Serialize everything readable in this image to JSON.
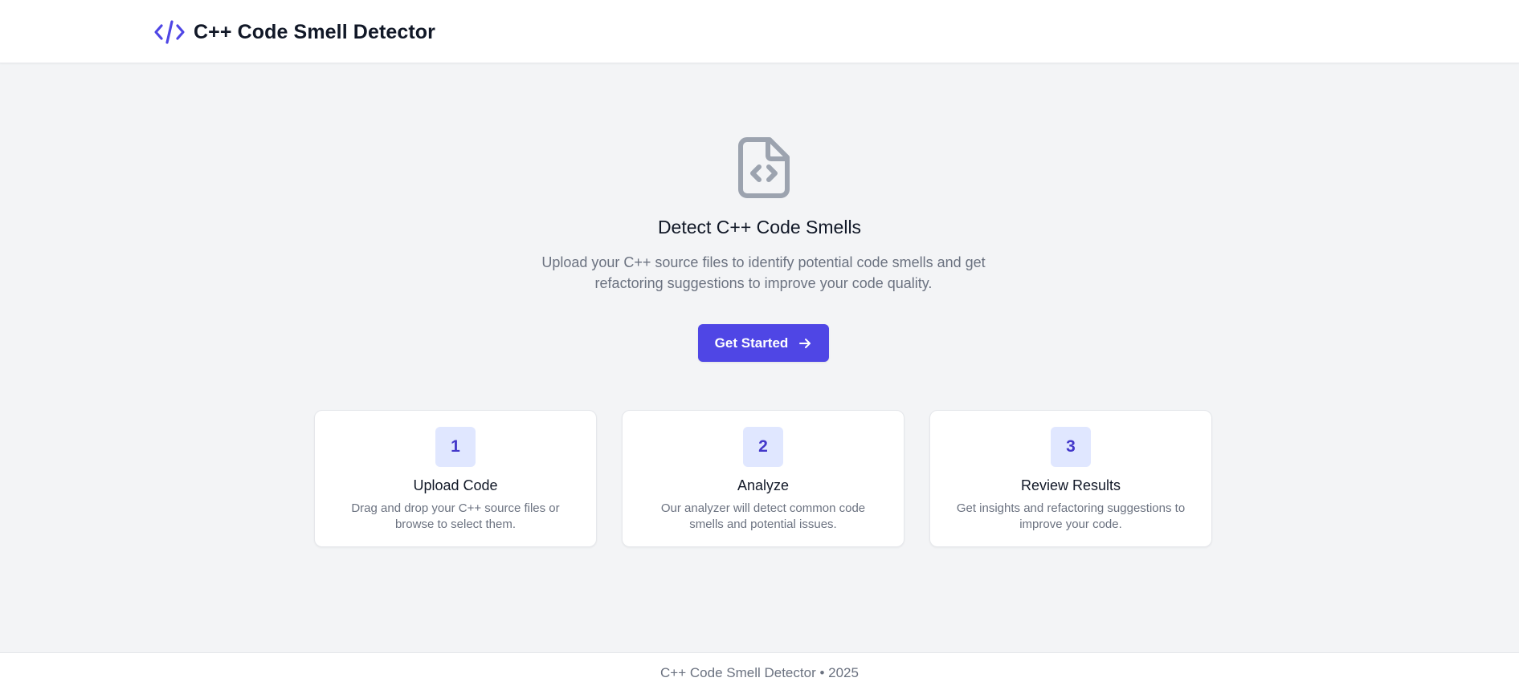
{
  "colors": {
    "accent": "#4f46e5",
    "badge_bg": "#e0e7ff",
    "badge_text": "#4338ca",
    "icon_gray": "#9ca3af",
    "page_bg": "#f3f4f6"
  },
  "header": {
    "icon": "code-icon",
    "title": "C++ Code Smell Detector"
  },
  "hero": {
    "icon": "file-code-icon",
    "title": "Detect C++ Code Smells",
    "description": "Upload your C++ source files to identify potential code smells and get refactoring suggestions to improve your code quality.",
    "cta_label": "Get Started",
    "cta_icon": "arrow-right-icon"
  },
  "steps": [
    {
      "number": "1",
      "title": "Upload Code",
      "description": "Drag and drop your C++ source files or browse to select them."
    },
    {
      "number": "2",
      "title": "Analyze",
      "description": "Our analyzer will detect common code smells and potential issues."
    },
    {
      "number": "3",
      "title": "Review Results",
      "description": "Get insights and refactoring suggestions to improve your code."
    }
  ],
  "footer": {
    "text": "C++ Code Smell Detector • 2025"
  }
}
